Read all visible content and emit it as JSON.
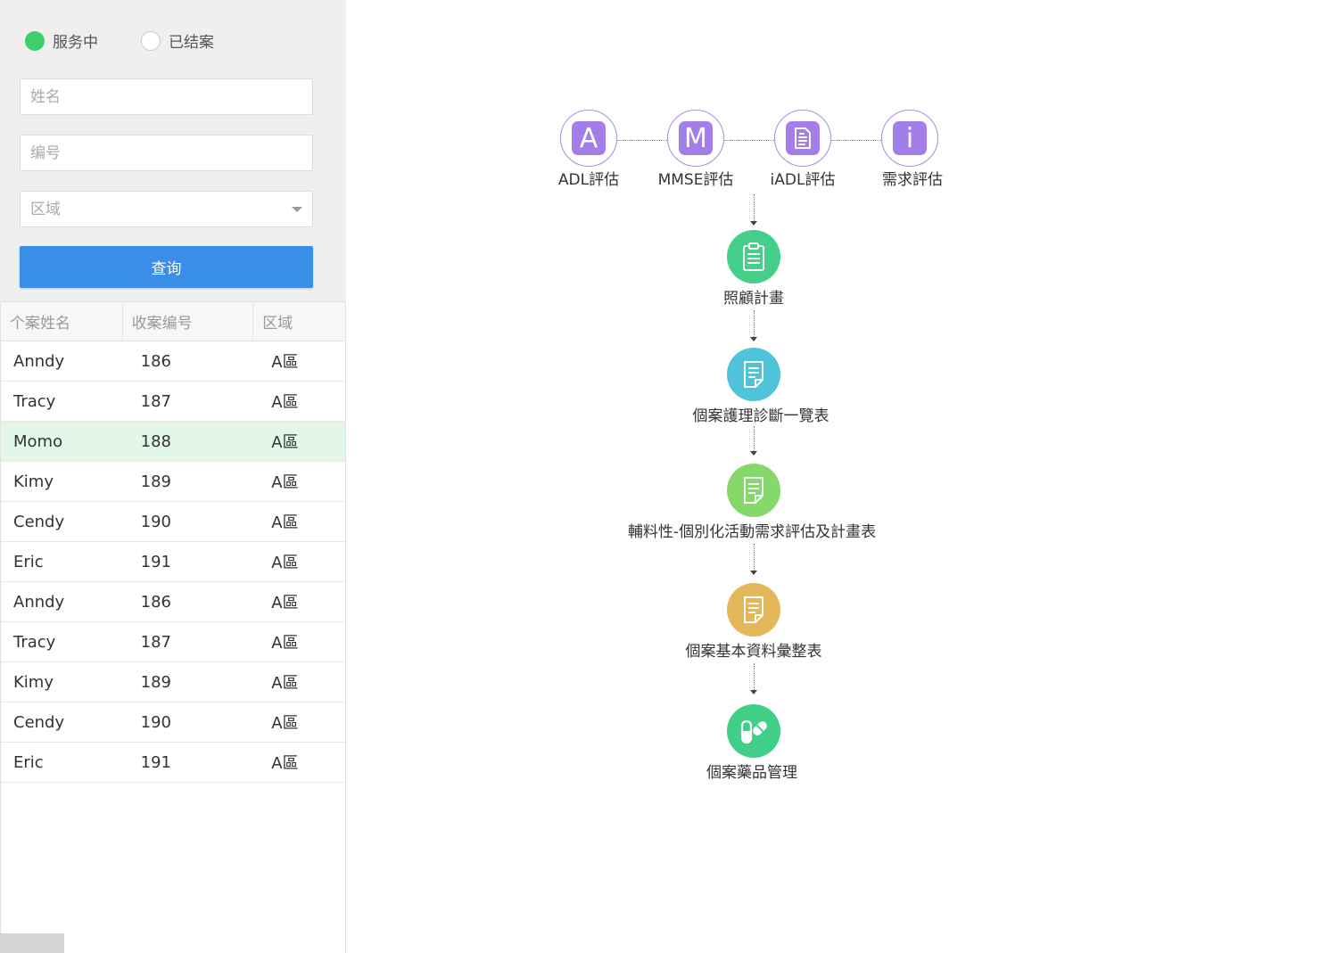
{
  "filters": {
    "status_options": [
      {
        "label": "服务中",
        "selected": true
      },
      {
        "label": "已结案",
        "selected": false
      }
    ],
    "name_placeholder": "姓名",
    "number_placeholder": "编号",
    "region_placeholder": "区域",
    "query_label": "查询"
  },
  "table": {
    "headers": [
      "个案姓名",
      "收案编号",
      "区域"
    ],
    "rows": [
      [
        "Anndy",
        "186",
        "A區"
      ],
      [
        "Tracy",
        "187",
        "A區"
      ],
      [
        "Momo",
        "188",
        "A區"
      ],
      [
        "Kimy",
        "189",
        "A區"
      ],
      [
        "Cendy",
        "190",
        "A區"
      ],
      [
        "Eric",
        "191",
        "A區"
      ],
      [
        "Anndy",
        "186",
        "A區"
      ],
      [
        "Tracy",
        "187",
        "A區"
      ],
      [
        "Kimy",
        "189",
        "A區"
      ],
      [
        "Cendy",
        "190",
        "A區"
      ],
      [
        "Eric",
        "191",
        "A區"
      ]
    ],
    "selected_row": "Momo"
  },
  "flow": {
    "evaluations": [
      {
        "glyph": "A",
        "label": "ADL評估",
        "icon": "letter-a-icon"
      },
      {
        "glyph": "M",
        "label": "MMSE評估",
        "icon": "letter-m-icon"
      },
      {
        "glyph": "",
        "label": "iADL評估",
        "icon": "document-icon"
      },
      {
        "glyph": "i",
        "label": "需求評估",
        "icon": "info-icon"
      }
    ],
    "steps": [
      {
        "label": "照顧計畫",
        "color": "#45cf8a",
        "icon": "clipboard-icon"
      },
      {
        "label": "個案護理診斷一覽表",
        "color": "#4fc3d9",
        "icon": "note-icon"
      },
      {
        "label": "輔料性-個別化活動需求評估及計畫表",
        "color": "#86d86a",
        "icon": "note-icon"
      },
      {
        "label": "個案基本資料彙整表",
        "color": "#e3b75a",
        "icon": "note-icon"
      },
      {
        "label": "個案藥品管理",
        "color": "#3fcf86",
        "icon": "pill-icon"
      }
    ]
  }
}
